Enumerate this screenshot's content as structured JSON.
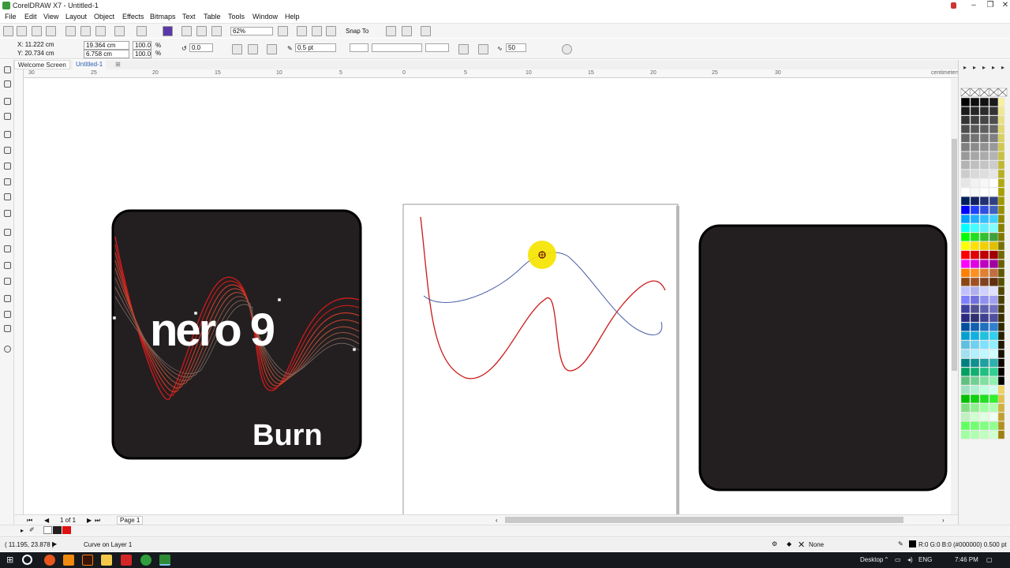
{
  "window": {
    "title": "CorelDRAW X7 - Untitled-1"
  },
  "menu": [
    "File",
    "Edit",
    "View",
    "Layout",
    "Object",
    "Effects",
    "Bitmaps",
    "Text",
    "Table",
    "Tools",
    "Window",
    "Help"
  ],
  "toolbar": {
    "zoom": "62%",
    "snap_to": "Snap To"
  },
  "properties": {
    "x": "X: 11.222 cm",
    "y": "Y: 20.734 cm",
    "width": "19.364 cm",
    "height": "6.758 cm",
    "scale_x": "100.0",
    "scale_y": "100.0",
    "percent": "%",
    "angle": "0.0",
    "outline_width": "0.5 pt",
    "smoothing": "50"
  },
  "tabs": {
    "welcome": "Welcome Screen",
    "doc": "Untitled-1"
  },
  "ruler": {
    "unit": "centimeters",
    "numbers": [
      "30",
      "25",
      "20",
      "15",
      "10",
      "5",
      "0",
      "5",
      "10",
      "15",
      "20",
      "25",
      "30"
    ]
  },
  "artwork": {
    "logo_word": "nero 9",
    "logo_sub": "Burn"
  },
  "pager": {
    "count": "1 of 1",
    "page": "Page 1"
  },
  "status": {
    "coords": "( 11.195, 23.878 )",
    "object": "Curve on Layer 1",
    "fill": "None",
    "outline_info": "R:0 G:0 B:0 (#000000)  0.500 pt"
  },
  "taskbar": {
    "desktop": "Desktop",
    "lang": "ENG",
    "time": "7:46 PM"
  },
  "colors": {
    "curve_red": "#cc1818",
    "curve_blue": "#4a5ea8",
    "tile_dark": "#231f20",
    "highlight": "#f5e400"
  }
}
